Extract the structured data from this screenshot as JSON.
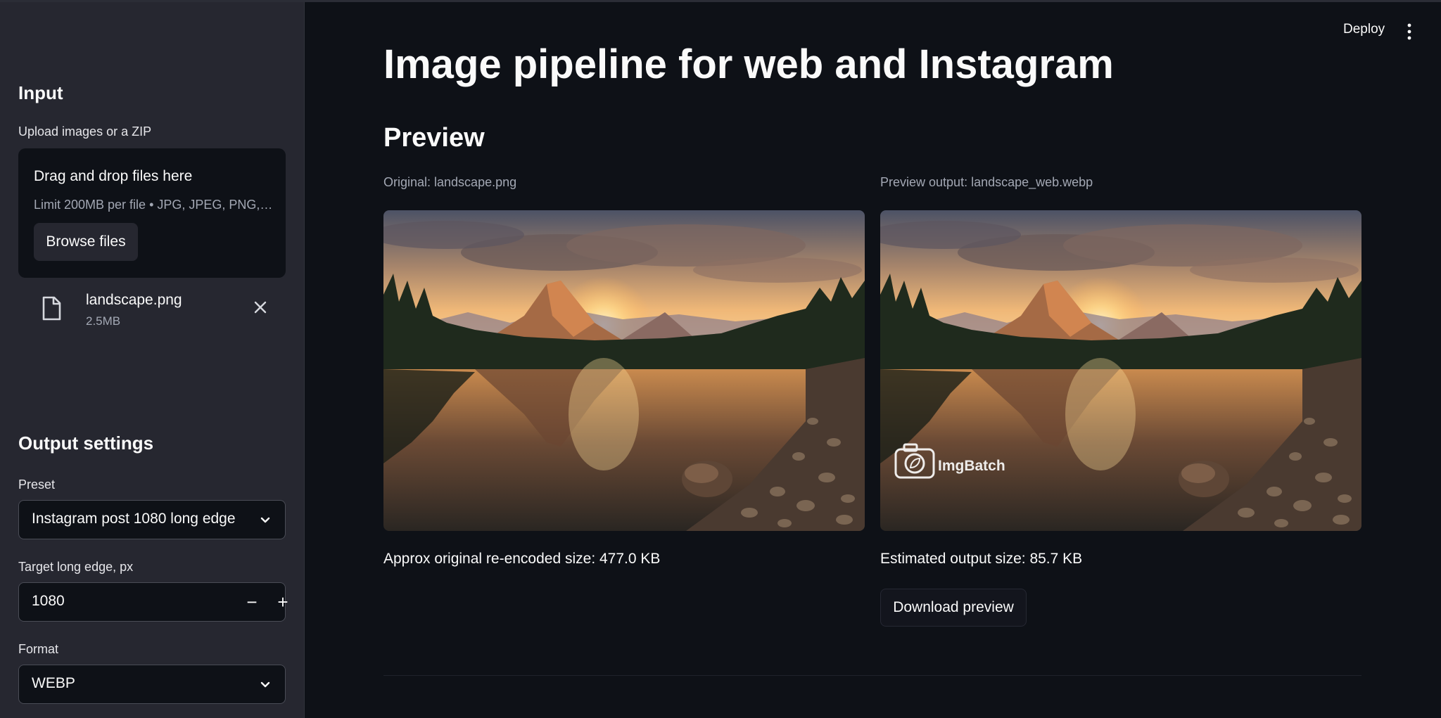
{
  "sidebar": {
    "input_heading": "Input",
    "upload_label": "Upload images or a ZIP",
    "dropzone": {
      "title": "Drag and drop files here",
      "subtitle": "Limit 200MB per file • JPG, JPEG, PNG, ...",
      "browse_label": "Browse files"
    },
    "file": {
      "name": "landscape.png",
      "size": "2.5MB"
    },
    "output_heading": "Output settings",
    "preset": {
      "label": "Preset",
      "value": "Instagram post 1080 long edge"
    },
    "long_edge": {
      "label": "Target long edge, px",
      "value": "1080",
      "minus": "−",
      "plus": "+"
    },
    "format": {
      "label": "Format",
      "value": "WEBP"
    }
  },
  "header": {
    "deploy_label": "Deploy"
  },
  "main": {
    "title": "Image pipeline for web and Instagram",
    "preview_heading": "Preview",
    "original_caption": "Original: landscape.png",
    "output_caption": "Preview output: landscape_web.webp",
    "watermark_text": "ImgBatch",
    "original_size": "Approx original re-encoded size: 477.0 KB",
    "output_size": "Estimated output size: 85.7 KB",
    "download_label": "Download preview"
  },
  "colors": {
    "background": "#0e1117",
    "sidebar": "#262730",
    "text": "#fafafa",
    "muted": "#a3a8b4"
  }
}
